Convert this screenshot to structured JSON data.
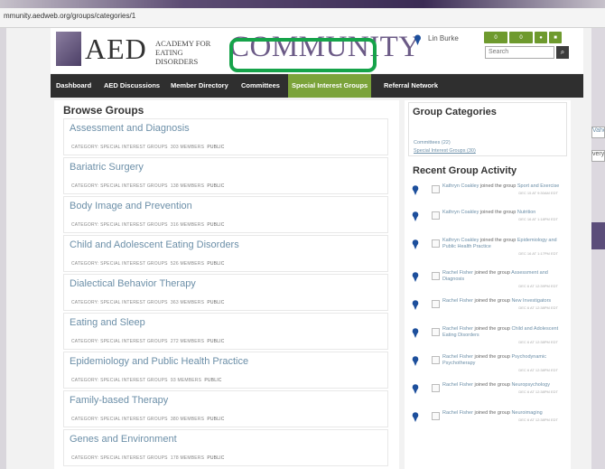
{
  "browser": {
    "url": "mmunity.aedweb.org/groups/categories/1"
  },
  "header": {
    "logo_aed": "AED",
    "logo_sub_line1": "ACADEMY FOR",
    "logo_sub_line2": "EATING DISORDERS",
    "logo_community": "COMMUNITY",
    "user_name": "Lin Burke",
    "tools": [
      "0",
      "0",
      "",
      ""
    ],
    "search_placeholder": "Search",
    "search_button": "⌕"
  },
  "nav": {
    "items": [
      "Dashboard",
      "AED Discussions",
      "Member Directory",
      "Committees",
      "Special Interest Groups",
      "Referral Network"
    ]
  },
  "browse": {
    "title": "Browse Groups",
    "groups": [
      {
        "name": "Assessment and Diagnosis",
        "category": "CATEGORY: SPECIAL INTEREST GROUPS",
        "members": "303 MEMBERS",
        "privacy": "PUBLIC"
      },
      {
        "name": "Bariatric Surgery",
        "category": "CATEGORY: SPECIAL INTEREST GROUPS",
        "members": "138 MEMBERS",
        "privacy": "PUBLIC"
      },
      {
        "name": "Body Image and Prevention",
        "category": "CATEGORY: SPECIAL INTEREST GROUPS",
        "members": "316 MEMBERS",
        "privacy": "PUBLIC"
      },
      {
        "name": "Child and Adolescent Eating Disorders",
        "category": "CATEGORY: SPECIAL INTEREST GROUPS",
        "members": "526 MEMBERS",
        "privacy": "PUBLIC"
      },
      {
        "name": "Dialectical Behavior Therapy",
        "category": "CATEGORY: SPECIAL INTEREST GROUPS",
        "members": "363 MEMBERS",
        "privacy": "PUBLIC"
      },
      {
        "name": "Eating and Sleep",
        "category": "CATEGORY: SPECIAL INTEREST GROUPS",
        "members": "272 MEMBERS",
        "privacy": "PUBLIC"
      },
      {
        "name": "Epidemiology and Public Health Practice",
        "category": "CATEGORY: SPECIAL INTEREST GROUPS",
        "members": "93 MEMBERS",
        "privacy": "PUBLIC"
      },
      {
        "name": "Family-based Therapy",
        "category": "CATEGORY: SPECIAL INTEREST GROUPS",
        "members": "380 MEMBERS",
        "privacy": "PUBLIC"
      },
      {
        "name": "Genes and Environment",
        "category": "CATEGORY: SPECIAL INTEREST GROUPS",
        "members": "178 MEMBERS",
        "privacy": "PUBLIC"
      }
    ]
  },
  "categories": {
    "title": "Group Categories",
    "links": [
      "Committees (22)",
      "Special Interest Groups (30)"
    ]
  },
  "activity": {
    "title": "Recent Group Activity",
    "items": [
      {
        "user": "Kathryn Coakley",
        "action": "joined the group",
        "group": "Sport and Exercise",
        "time": "DEC 15 AT 9:30AM EDT"
      },
      {
        "user": "Kathryn Coakley",
        "action": "joined the group",
        "group": "Nutrition",
        "time": "DEC 16 AT 1:18PM EDT"
      },
      {
        "user": "Kathryn Coakley",
        "action": "joined the group",
        "group": "Epidemiology and Public Health Practice",
        "time": "DEC 16 AT 1:17PM EDT"
      },
      {
        "user": "Rachel Fisher",
        "action": "joined the group",
        "group": "Assessment and Diagnosis",
        "time": "DEC 6 AT 12:39PM EDT"
      },
      {
        "user": "Rachel Fisher",
        "action": "joined the group",
        "group": "New Investigators",
        "time": "DEC 6 AT 12:38PM EDT"
      },
      {
        "user": "Rachel Fisher",
        "action": "joined the group",
        "group": "Child and Adolescent Eating Disorders",
        "time": "DEC 6 AT 12:38PM EDT"
      },
      {
        "user": "Rachel Fisher",
        "action": "joined the group",
        "group": "Psychodynamic Psychotherapy",
        "time": "DEC 6 AT 12:38PM EDT"
      },
      {
        "user": "Rachel Fisher",
        "action": "joined the group",
        "group": "Neuropsychology",
        "time": "DEC 6 AT 12:38PM EDT"
      },
      {
        "user": "Rachel Fisher",
        "action": "joined the group",
        "group": "Neuroimaging",
        "time": "DEC 6 AT 12:38PM EDT"
      }
    ]
  },
  "right_edge": {
    "input1": "Vaho",
    "input2": "very"
  },
  "colors": {
    "accent_green": "#7ba33a",
    "link_blue": "#6c8fa8",
    "highlight": "#16a34a",
    "nav_bg": "#2f2f2f",
    "community_purple": "#6b5a86"
  }
}
